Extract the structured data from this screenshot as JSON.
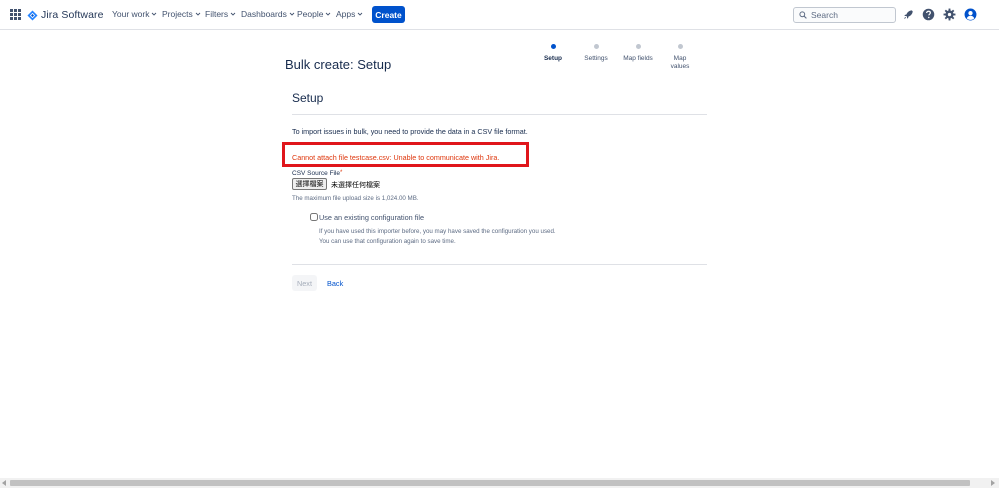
{
  "nav": {
    "product_name": "Jira Software",
    "items": [
      {
        "label": "Your work"
      },
      {
        "label": "Projects"
      },
      {
        "label": "Filters"
      },
      {
        "label": "Dashboards"
      },
      {
        "label": "People"
      },
      {
        "label": "Apps"
      }
    ],
    "create_label": "Create",
    "search_placeholder": "Search",
    "accent_color": "#0052cc"
  },
  "page": {
    "title": "Bulk create: Setup",
    "steps": [
      {
        "label": "Setup",
        "active": true
      },
      {
        "label": "Settings",
        "active": false
      },
      {
        "label": "Map fields",
        "active": false
      },
      {
        "label": "Map values",
        "active": false
      }
    ],
    "section_title": "Setup",
    "intro": "To import issues in bulk, you need to provide the data in a CSV file format.",
    "error": "Cannot attach file testcase.csv: Unable to communicate with Jira.",
    "error_color": "#de350b",
    "highlight_color": "#e0161b",
    "csv_label": "CSV Source File",
    "required_mark": "*",
    "file_button": "選擇檔案",
    "file_none": "未選擇任何檔案",
    "max_size": "The maximum file upload size is 1,024.00 MB.",
    "config_label": "Use an existing configuration file",
    "config_checked": false,
    "config_help_1": "If you have used this importer before, you may have saved the configuration you used.",
    "config_help_2": "You can use that configuration again to save time.",
    "next_label": "Next",
    "back_label": "Back"
  }
}
